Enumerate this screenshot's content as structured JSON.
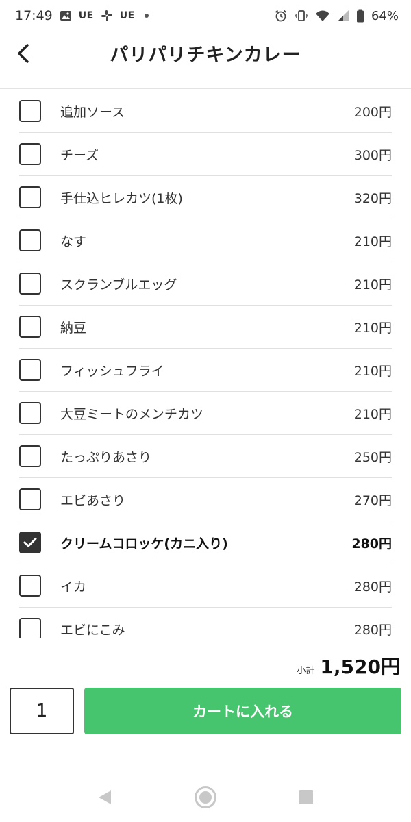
{
  "status_bar": {
    "time": "17:49",
    "icons_left": [
      "image-icon",
      "ue-label",
      "slack-icon",
      "ue-label",
      "dot-icon"
    ],
    "ue_label_1": "UE",
    "ue_label_2": "UE",
    "icons_right": [
      "alarm-icon",
      "vibrate-icon",
      "wifi-icon",
      "signal-icon",
      "battery-icon"
    ],
    "battery": "64%"
  },
  "header": {
    "title": "パリパリチキンカレー",
    "back_icon": "chevron-left-icon"
  },
  "options": [
    {
      "name": "追加ソース",
      "price": "200円",
      "checked": false
    },
    {
      "name": "チーズ",
      "price": "300円",
      "checked": false
    },
    {
      "name": "手仕込ヒレカツ(1枚)",
      "price": "320円",
      "checked": false
    },
    {
      "name": "なす",
      "price": "210円",
      "checked": false
    },
    {
      "name": "スクランブルエッグ",
      "price": "210円",
      "checked": false
    },
    {
      "name": "納豆",
      "price": "210円",
      "checked": false
    },
    {
      "name": "フィッシュフライ",
      "price": "210円",
      "checked": false
    },
    {
      "name": "大豆ミートのメンチカツ",
      "price": "210円",
      "checked": false
    },
    {
      "name": "たっぷりあさり",
      "price": "250円",
      "checked": false
    },
    {
      "name": "エビあさり",
      "price": "270円",
      "checked": false
    },
    {
      "name": "クリームコロッケ(カニ入り)",
      "price": "280円",
      "checked": true
    },
    {
      "name": "イカ",
      "price": "280円",
      "checked": false
    },
    {
      "name": "エビにこみ",
      "price": "280円",
      "checked": false
    }
  ],
  "footer": {
    "subtotal_label": "小計",
    "subtotal_value": "1,520円",
    "quantity": "1",
    "cart_button_label": "カートに入れる"
  },
  "colors": {
    "accent": "#47c46e",
    "checkbox_checked": "#333333"
  },
  "nav_bar": {
    "icons": [
      "back-triangle-icon",
      "home-circle-icon",
      "recents-square-icon"
    ]
  }
}
